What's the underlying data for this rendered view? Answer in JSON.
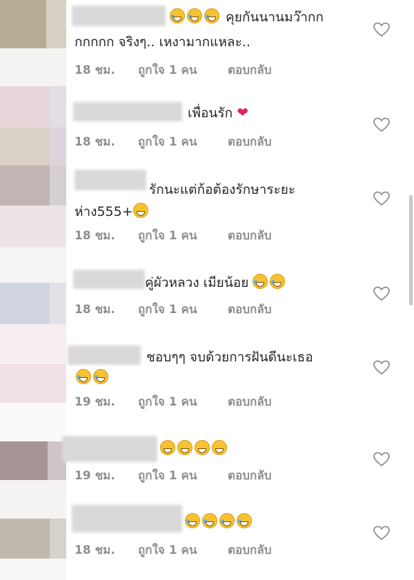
{
  "comments": [
    {
      "text_lines": [
        "คุยกันนานมว๊ากก",
        "กกกกก จริงๆ.. เหงามากแหละ.."
      ],
      "time": "18 ชม.",
      "likes": "ถูกใจ 1 คน",
      "reply": "ตอบกลับ",
      "emoji_count": 3
    },
    {
      "text_lines": [
        "เพื่อนรัก"
      ],
      "time": "18 ชม.",
      "likes": "ถูกใจ 1 คน",
      "reply": "ตอบกลับ",
      "emoji_count": 1
    },
    {
      "text_lines": [
        "รักนะแต่ก้อต้องรักษาระยะ",
        "ห่าง555+"
      ],
      "time": "18 ชม.",
      "likes": "ถูกใจ 1 คน",
      "reply": "ตอบกลับ",
      "emoji_count": 1
    },
    {
      "text_lines": [
        "คู่ผัวหลวง เมียน้อย"
      ],
      "time": "18 ชม.",
      "likes": "ถูกใจ 1 คน",
      "reply": "ตอบกลับ",
      "emoji_count": 2
    },
    {
      "text_lines": [
        "ชอบๆๆ จบด้วยการฝันดีนะเธอ"
      ],
      "time": "19 ชม.",
      "likes": "ถูกใจ 1 คน",
      "reply": "ตอบกลับ",
      "emoji_count": 2
    },
    {
      "text_lines": [
        ""
      ],
      "time": "19 ชม.",
      "likes": "ถูกใจ 1 คน",
      "reply": "ตอบกลับ",
      "emoji_count": 4
    },
    {
      "text_lines": [
        ""
      ],
      "time": "18 ชม.",
      "likes": "ถูกใจ 1 คน",
      "reply": "ตอบกลับ",
      "emoji_count": 4
    }
  ],
  "colors": {
    "text": "#262626",
    "meta": "#8e8e8e",
    "emoji": "#f7c232"
  },
  "icons": {
    "like": "heart-outline-icon",
    "emoji": "emoji-icon"
  }
}
